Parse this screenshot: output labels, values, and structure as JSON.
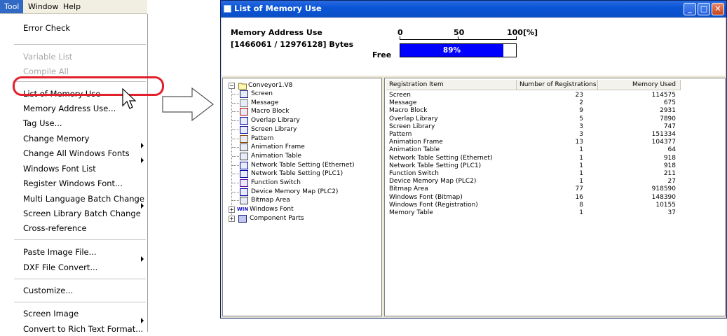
{
  "menubar": {
    "items": [
      "Tool",
      "Window",
      "Help"
    ]
  },
  "menu": {
    "items": [
      {
        "label": "Error Check"
      },
      {
        "label": "Variable List"
      },
      {
        "label": "Compile All"
      },
      {
        "label": "List of Memory Use"
      },
      {
        "label": "Memory Address Use..."
      },
      {
        "label": "Tag Use..."
      },
      {
        "label": "Change Memory"
      },
      {
        "label": "Change All Windows Fonts"
      },
      {
        "label": "Windows Font List"
      },
      {
        "label": "Register Windows Font..."
      },
      {
        "label": "Multi Language Batch Change"
      },
      {
        "label": "Screen Library Batch Change"
      },
      {
        "label": "Cross-reference"
      },
      {
        "label": "Paste Image File..."
      },
      {
        "label": "DXF File Convert..."
      },
      {
        "label": "Customize..."
      },
      {
        "label": "Screen Image"
      },
      {
        "label": "Convert to Rich Text Format..."
      }
    ]
  },
  "window": {
    "title": "List of Memory Use",
    "minimize_glyph": "_",
    "maximize_glyph": "□",
    "close_glyph": "✕"
  },
  "memory": {
    "heading": "Memory Address Use",
    "bytes": "[1466061 / 12976128] Bytes",
    "scale": [
      "0",
      "50",
      "100[%]"
    ],
    "free_label": "Free",
    "free_text": "89%",
    "free_fraction": 0.89
  },
  "tree": {
    "root": "Conveyor1.V8",
    "items": [
      {
        "label": "Screen",
        "icon": "screen-icon"
      },
      {
        "label": "Message",
        "icon": "message-icon"
      },
      {
        "label": "Macro Block",
        "icon": "macro-icon"
      },
      {
        "label": "Overlap Library",
        "icon": "overlap-library-icon"
      },
      {
        "label": "Screen Library",
        "icon": "screen-library-icon"
      },
      {
        "label": "Pattern",
        "icon": "pattern-icon"
      },
      {
        "label": "Animation Frame",
        "icon": "animation-frame-icon"
      },
      {
        "label": "Animation Table",
        "icon": "animation-table-icon"
      },
      {
        "label": "Network Table Setting (Ethernet)",
        "icon": "network-table-icon"
      },
      {
        "label": "Network Table Setting (PLC1)",
        "icon": "network-table-icon"
      },
      {
        "label": "Function Switch",
        "icon": "function-switch-icon"
      },
      {
        "label": "Device Memory Map (PLC2)",
        "icon": "device-memory-icon"
      },
      {
        "label": "Bitmap Area",
        "icon": "bitmap-area-icon"
      }
    ],
    "expandables": [
      {
        "label": "Windows Font",
        "icon_text": "WIN"
      },
      {
        "label": "Component Parts",
        "icon": "component-parts-icon"
      }
    ]
  },
  "table": {
    "headers": [
      "Registration Item",
      "Number of Registrations",
      "Memory Used"
    ],
    "rows": [
      [
        "Screen",
        "23",
        "114575"
      ],
      [
        "Message",
        "2",
        "675"
      ],
      [
        "Macro Block",
        "9",
        "2931"
      ],
      [
        "Overlap Library",
        "5",
        "7890"
      ],
      [
        "Screen Library",
        "3",
        "747"
      ],
      [
        "Pattern",
        "3",
        "151334"
      ],
      [
        "Animation Frame",
        "13",
        "104377"
      ],
      [
        "Animation Table",
        "1",
        "64"
      ],
      [
        "Network Table Setting (Ethernet)",
        "1",
        "918"
      ],
      [
        "Network Table Setting (PLC1)",
        "1",
        "918"
      ],
      [
        "Function Switch",
        "1",
        "211"
      ],
      [
        "Device Memory Map (PLC2)",
        "1",
        "27"
      ],
      [
        "Bitmap Area",
        "77",
        "918590"
      ],
      [
        "Windows Font (Bitmap)",
        "16",
        "148390"
      ],
      [
        "Windows Font (Registration)",
        "8",
        "10155"
      ],
      [
        "Memory Table",
        "1",
        "37"
      ]
    ]
  },
  "colors": {
    "title_bar": "#0a55d6",
    "highlight": "#e2202b",
    "bar_fill": "#0000ff",
    "menu_active": "#316ac5"
  }
}
